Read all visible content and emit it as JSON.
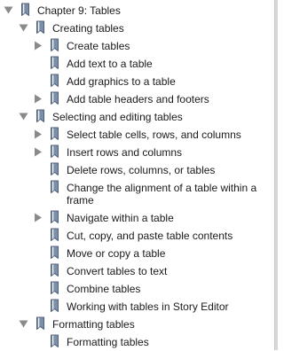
{
  "colors": {
    "triangle": "#8a8a8a",
    "book_fill": "#7d8fa6",
    "book_stroke": "#4f6079",
    "book_page": "#eef1f5"
  },
  "icons": {
    "expanded": "disclosure-triangle-down-icon",
    "collapsed": "disclosure-triangle-right-icon",
    "topic": "book-icon"
  },
  "tree": [
    {
      "label": "Chapter 9: Tables",
      "level": 0,
      "toggle": "expanded"
    },
    {
      "label": "Creating tables",
      "level": 1,
      "toggle": "expanded"
    },
    {
      "label": "Create tables",
      "level": 2,
      "toggle": "collapsed"
    },
    {
      "label": "Add text to a table",
      "level": 2,
      "toggle": "none"
    },
    {
      "label": "Add graphics to a table",
      "level": 2,
      "toggle": "none"
    },
    {
      "label": "Add table headers and footers",
      "level": 2,
      "toggle": "collapsed"
    },
    {
      "label": "Selecting and editing tables",
      "level": 1,
      "toggle": "expanded"
    },
    {
      "label": "Select table cells, rows, and columns",
      "level": 2,
      "toggle": "collapsed"
    },
    {
      "label": "Insert rows and columns",
      "level": 2,
      "toggle": "collapsed"
    },
    {
      "label": "Delete rows, columns, or tables",
      "level": 2,
      "toggle": "none"
    },
    {
      "label": "Change the alignment of a table within a frame",
      "level": 2,
      "toggle": "none"
    },
    {
      "label": "Navigate within a table",
      "level": 2,
      "toggle": "collapsed"
    },
    {
      "label": "Cut, copy, and paste table contents",
      "level": 2,
      "toggle": "none"
    },
    {
      "label": "Move or copy a table",
      "level": 2,
      "toggle": "none"
    },
    {
      "label": "Convert tables to text",
      "level": 2,
      "toggle": "none"
    },
    {
      "label": "Combine tables",
      "level": 2,
      "toggle": "none"
    },
    {
      "label": "Working with tables in Story Editor",
      "level": 2,
      "toggle": "none"
    },
    {
      "label": "Formatting tables",
      "level": 1,
      "toggle": "expanded"
    },
    {
      "label": "Formatting tables",
      "level": 2,
      "toggle": "none"
    }
  ]
}
